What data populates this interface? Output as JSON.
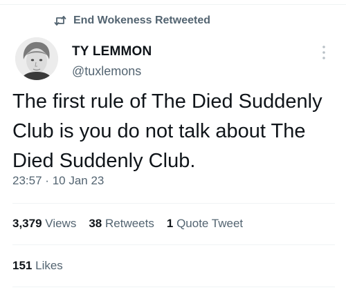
{
  "retweet_context": {
    "icon": "retweet-icon",
    "label": "End Wokeness Retweeted"
  },
  "author": {
    "display_name": "TY LEMMON",
    "handle": "@tuxlemons",
    "avatar": "profile-photo"
  },
  "tweet": {
    "text": "The first rule of The Died Suddenly Club is you do not talk about The Died Suddenly Club.",
    "time": "23:57",
    "separator": "·",
    "date": "10 Jan 23"
  },
  "stats": {
    "views": {
      "count": "3,379",
      "label": "Views"
    },
    "retweets": {
      "count": "38",
      "label": "Retweets"
    },
    "quotes": {
      "count": "1",
      "label": "Quote Tweet"
    },
    "likes": {
      "count": "151",
      "label": "Likes"
    }
  },
  "colors": {
    "text": "#0f1419",
    "secondary": "#536471",
    "divider": "#eff3f4"
  }
}
